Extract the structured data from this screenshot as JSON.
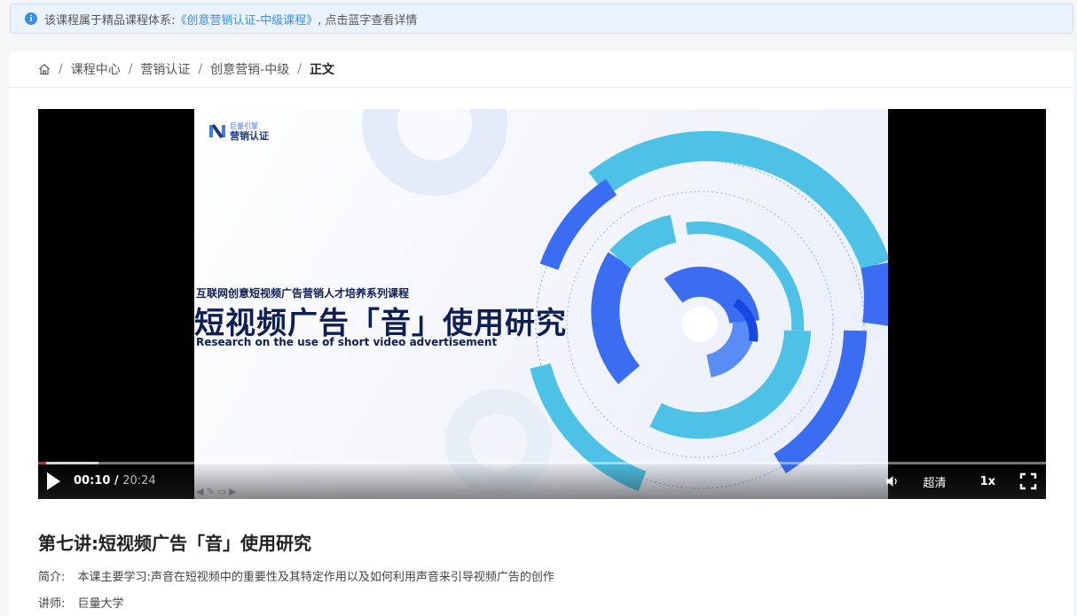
{
  "notice": {
    "prefix": "该课程属于精品课程体系:",
    "link_text": "《创意营销认证-中级课程》",
    "suffix": ", 点击蓝字查看详情"
  },
  "breadcrumb": {
    "items": [
      "课程中心",
      "营销认证",
      "创意营销-中级"
    ],
    "current": "正文",
    "separator": "/"
  },
  "slide": {
    "brand_small": "巨量引擎",
    "brand_big": "营销认证",
    "series": "互联网创意短视频广告营销人才培养系列课程",
    "title_cn": "短视频广告「音」使用研究",
    "title_en": "Research on the use of short video advertisement",
    "colors": {
      "primary": "#3b6df2",
      "secondary": "#4ec2e6",
      "dark": "#0e1f56"
    }
  },
  "player": {
    "current_time": "00:10",
    "time_separator": " / ",
    "total_time": "20:24",
    "progress_played": 0.008,
    "progress_buffered": 0.06,
    "quality_label": "超清",
    "speed_label": "1x",
    "icons": [
      "play-icon",
      "volume-icon",
      "fullscreen-icon"
    ]
  },
  "lesson": {
    "title": "第七讲:短视频广告「音」使用研究",
    "intro_label": "简介:",
    "intro_text": "本课主要学习:声音在短视频中的重要性及其特定作用以及如何利用声音来引导视频广告的创作",
    "teacher_label": "讲师:",
    "teacher_name": "巨量大学"
  }
}
